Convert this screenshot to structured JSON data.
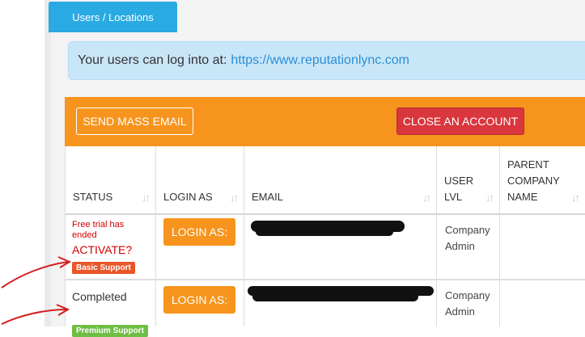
{
  "tab": {
    "label": "Users / Locations"
  },
  "info": {
    "prefix": "Your users can log into at:",
    "url": "https://www.reputationlync.com"
  },
  "actions": {
    "mass_email": "SEND MASS EMAIL",
    "close_account": "CLOSE AN ACCOUNT"
  },
  "table": {
    "headers": {
      "status": "STATUS",
      "login_as": "LOGIN AS",
      "email": "EMAIL",
      "user_lvl_1": "USER",
      "user_lvl_2": "LVL",
      "parent_1": "PARENT",
      "parent_2": "COMPANY",
      "parent_3": "NAME"
    },
    "rows": [
      {
        "status_line1": "Free trial has",
        "status_line2": "ended",
        "activate": "ACTIVATE?",
        "badge": "Basic Support",
        "login": "LOGIN AS:",
        "lvl_1": "Company",
        "lvl_2": "Admin"
      },
      {
        "status": "Completed",
        "badge": "Premium Support",
        "login": "LOGIN AS:",
        "lvl_1": "Company",
        "lvl_2": "Admin"
      }
    ]
  },
  "colors": {
    "tab": "#2aaae2",
    "orange": "#f7941d",
    "danger": "#d9363e",
    "basic_badge": "#e8562a",
    "premium_badge": "#6ebd44",
    "link": "#2a8fd7"
  }
}
